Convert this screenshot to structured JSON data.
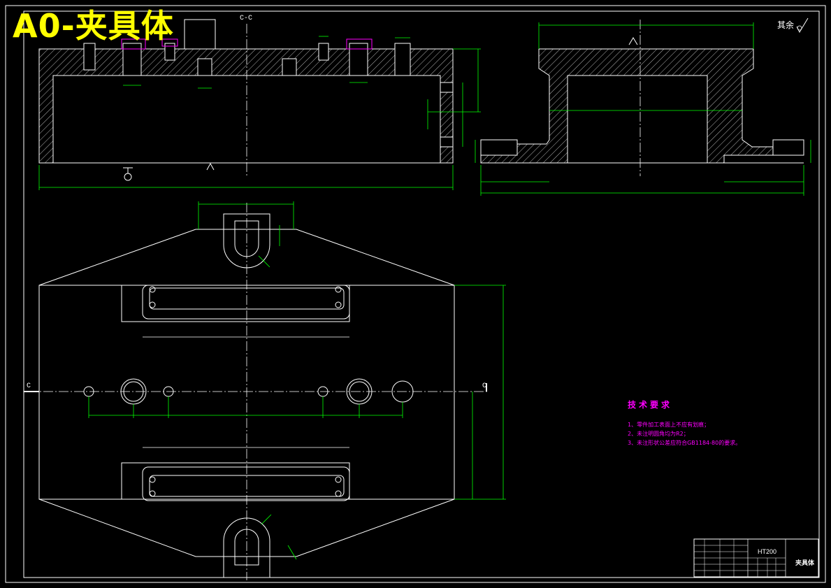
{
  "title": "A0-夹具体",
  "section_labels": {
    "top": "C-C",
    "left": "C",
    "right": "C"
  },
  "roughness_note": "其余",
  "tech_requirements": {
    "heading": "技术要求",
    "items": [
      "1、零件加工表面上不应有划痕；",
      "2、未注明圆角均为R2；",
      "3、未注形状公差应符合GB1184-80的要求。"
    ]
  },
  "title_block": {
    "material": "HT200",
    "part_name": "夹具体"
  },
  "colors": {
    "background": "#000000",
    "outline": "#ffffff",
    "dimension": "#00ff00",
    "title": "#ffff00",
    "notes": "#ff00ff",
    "centerline": "#ffffff"
  }
}
